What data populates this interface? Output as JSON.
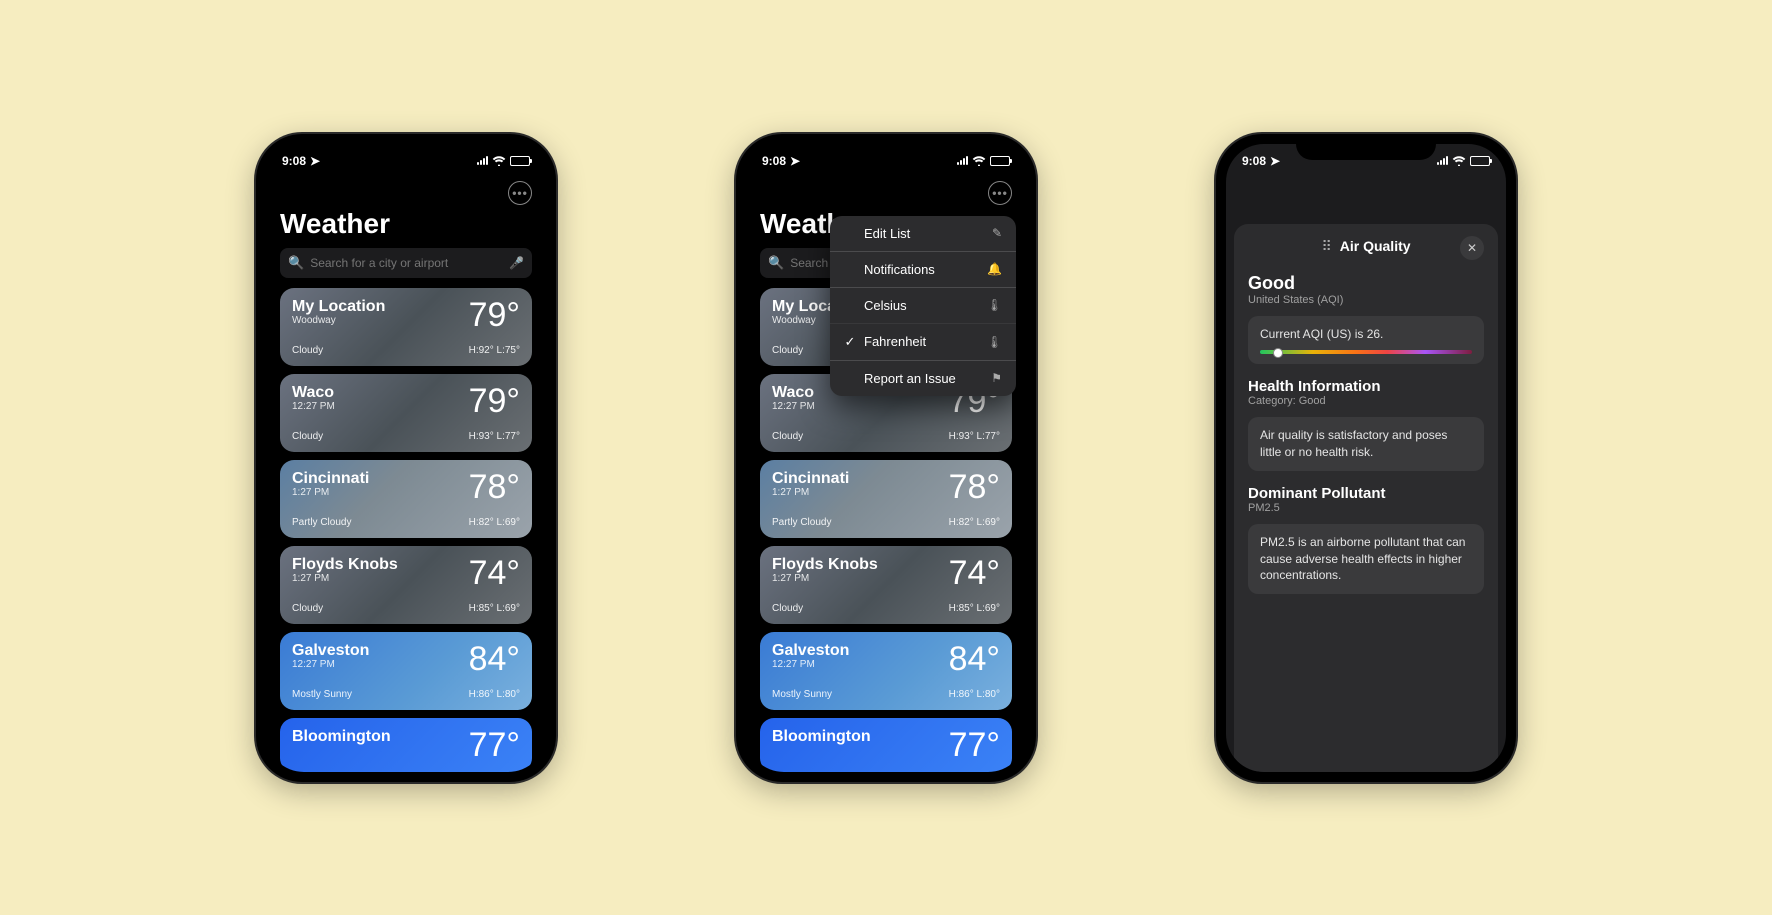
{
  "status": {
    "time": "9:08"
  },
  "app_title": "Weather",
  "search": {
    "placeholder": "Search for a city or airport"
  },
  "cities": [
    {
      "name": "My Location",
      "sub": "Woodway",
      "temp": "79°",
      "cond": "Cloudy",
      "hi": "H:92°",
      "lo": "L:75°",
      "bg": "bg-cloudy"
    },
    {
      "name": "Waco",
      "sub": "12:27 PM",
      "temp": "79°",
      "cond": "Cloudy",
      "hi": "H:93°",
      "lo": "L:77°",
      "bg": "bg-cloudy"
    },
    {
      "name": "Cincinnati",
      "sub": "1:27 PM",
      "temp": "78°",
      "cond": "Partly Cloudy",
      "hi": "H:82°",
      "lo": "L:69°",
      "bg": "bg-partly"
    },
    {
      "name": "Floyds Knobs",
      "sub": "1:27 PM",
      "temp": "74°",
      "cond": "Cloudy",
      "hi": "H:85°",
      "lo": "L:69°",
      "bg": "bg-cloudy"
    },
    {
      "name": "Galveston",
      "sub": "12:27 PM",
      "temp": "84°",
      "cond": "Mostly Sunny",
      "hi": "H:86°",
      "lo": "L:80°",
      "bg": "bg-sunny"
    },
    {
      "name": "Bloomington",
      "sub": "",
      "temp": "77°",
      "cond": "",
      "hi": "",
      "lo": "",
      "bg": "bg-blue"
    }
  ],
  "menu": {
    "edit": "Edit List",
    "notifications": "Notifications",
    "celsius": "Celsius",
    "fahrenheit": "Fahrenheit",
    "report": "Report an Issue"
  },
  "aq": {
    "title": "Air Quality",
    "status": "Good",
    "region": "United States (AQI)",
    "current": "Current AQI (US) is 26.",
    "health_h": "Health Information",
    "health_sub": "Category: Good",
    "health_body": "Air quality is satisfactory and poses little or no health risk.",
    "pollutant_h": "Dominant Pollutant",
    "pollutant_sub": "PM2.5",
    "pollutant_body": "PM2.5 is an airborne pollutant that can cause adverse health effects in higher concentrations."
  }
}
